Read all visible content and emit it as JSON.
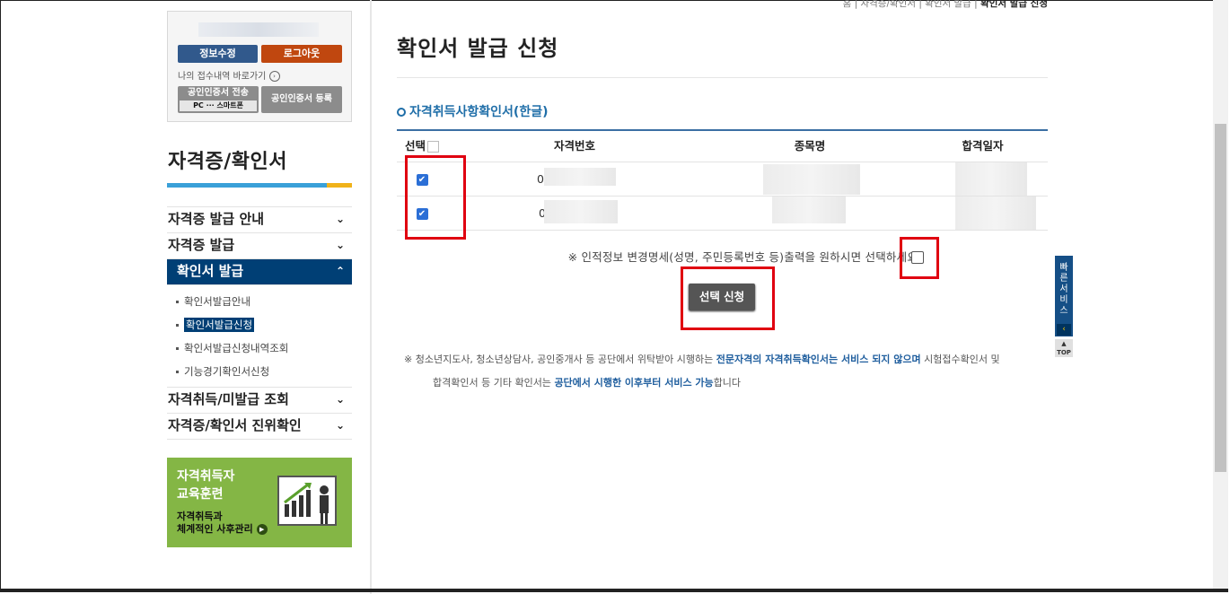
{
  "login": {
    "edit_label": "정보수정",
    "logout_label": "로그아웃",
    "recent_link": "나의 접수내역 바로가기",
    "cert_send_label": "공인인증서 전송",
    "cert_send_sub": "PC ··· 스마트폰",
    "cert_register_label": "공인인증서 등록"
  },
  "sidebar": {
    "title": "자격증/확인서",
    "menu": [
      {
        "label": "자격증 발급 안내",
        "chev": "⌄"
      },
      {
        "label": "자격증 발급",
        "chev": "⌄"
      },
      {
        "label": "확인서 발급",
        "chev": "⌃"
      },
      {
        "label": "자격취득/미발급 조회",
        "chev": "⌄"
      },
      {
        "label": "자격증/확인서 진위확인",
        "chev": "⌄"
      }
    ],
    "sub_items": [
      "확인서발급안내",
      "확인서발급신청",
      "확인서발급신청내역조회",
      "기능경기확인서신청"
    ]
  },
  "banner": {
    "heading_1": "자격취득자",
    "heading_2": "교육훈련",
    "desc_1": "자격취득과",
    "desc_2": "체계적인 사후관리"
  },
  "breadcrumb": {
    "home": "홈",
    "level1": "자격증/확인서",
    "level2": "확인서 발급",
    "current": "확인서 발급 신청"
  },
  "page": {
    "title": "확인서 발급 신청",
    "section_title": "자격취득사항확인서(한글)"
  },
  "table": {
    "headers": [
      "선택",
      "자격번호",
      "종목명",
      "합격일자"
    ],
    "rows": [
      {
        "checked": true,
        "cert_no_prefix": "0"
      },
      {
        "checked": true,
        "cert_no_prefix": "0"
      }
    ]
  },
  "notice": "※ 인적정보 변경명세(성명, 주민등록번호 등)출력을 원하시면 선택하세요",
  "submit_label": "선택 신청",
  "footnote": {
    "part1": "※ 청소년지도사, 청소년상담사, 공인중개사 등 공단에서 위탁받아 시행하는 ",
    "bold1": "전문자격의 자격취득확인서는 서비스 되지 않으며",
    "part2": " 시험접수확인서 및",
    "part3": "합격확인서 등 기타 확인서는 ",
    "bold2": "공단에서 시행한 이후부터 서비스 가능",
    "part4": "합니다"
  },
  "quick_service": {
    "label": "빠른서비스",
    "top_label": "TOP"
  },
  "colors": {
    "accent_blue": "#003f75",
    "highlight_red": "#e00010",
    "logout_orange": "#c0470f",
    "banner_green": "#84b645"
  }
}
